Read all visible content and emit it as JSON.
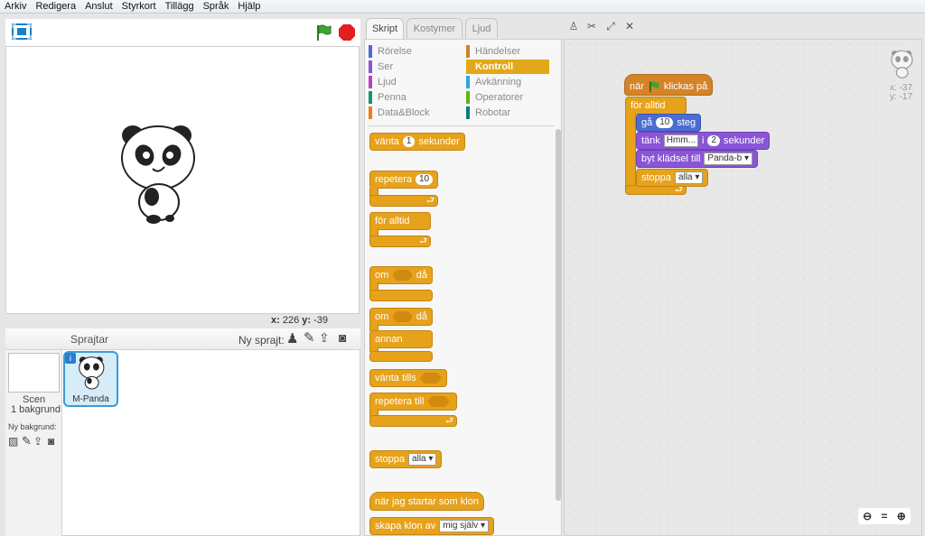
{
  "menu": [
    "Arkiv",
    "Redigera",
    "Anslut",
    "Styrkort",
    "Tillägg",
    "Språk",
    "Hjälp"
  ],
  "stage": {
    "coords": {
      "x_label": "x:",
      "x_value": "226",
      "y_label": "y:",
      "y_value": "-39"
    }
  },
  "sprites": {
    "header_label": "Sprajtar",
    "new_sprite_label": "Ny sprajt:",
    "stage_name": "Scen",
    "stage_backdrops": "1 bakgrund",
    "new_backdrop_label": "Ny bakgrund:",
    "selected_sprite": "M-Panda"
  },
  "tabs": [
    "Skript",
    "Kostymer",
    "Ljud"
  ],
  "categories_left": [
    {
      "label": "Rörelse",
      "color": "#4a6cd4"
    },
    {
      "label": "Ser",
      "color": "#8a55d7"
    },
    {
      "label": "Ljud",
      "color": "#bb42c3"
    },
    {
      "label": "Penna",
      "color": "#0e9a6c"
    },
    {
      "label": "Data&Block",
      "color": "#ee7d16"
    }
  ],
  "categories_right": [
    {
      "label": "Händelser",
      "color": "#c88330"
    },
    {
      "label": "Kontroll",
      "color": "#e1a91a"
    },
    {
      "label": "Avkänning",
      "color": "#2ca5e2"
    },
    {
      "label": "Operatorer",
      "color": "#5cb712"
    },
    {
      "label": "Robotar",
      "color": "#0e7a82"
    }
  ],
  "palette": {
    "wait": "vänta",
    "wait_val": "1",
    "wait_unit": "sekunder",
    "repeat": "repetera",
    "repeat_val": "10",
    "forever": "för alltid",
    "if": "om",
    "then": "då",
    "if2": "om",
    "then2": "då",
    "else": "annan",
    "wait_until": "vänta tills",
    "repeat_until": "repetera till",
    "stop": "stoppa",
    "stop_val": "alla",
    "clone_start": "när jag startar som klon",
    "create_clone": "skapa klon av",
    "create_clone_val": "mig själv"
  },
  "script": {
    "hat_prefix": "när",
    "hat_suffix": "klickas på",
    "forever": "för alltid",
    "move": "gå",
    "move_val": "10",
    "move_unit": "steg",
    "think": "tänk",
    "think_val": "Hmm...",
    "think_in": "i",
    "think_secs": "2",
    "think_unit": "sekunder",
    "switch": "byt klädsel till",
    "switch_val": "Panda-b",
    "stop": "stoppa",
    "stop_val": "alla"
  },
  "sprite_info": {
    "x": "x: -37",
    "y": "y: -17"
  },
  "colors": {
    "control": "#e6a21b",
    "events": "#d48329",
    "motion": "#4a6cd4",
    "looks": "#8a55d7",
    "selection": "#3a9ad9"
  }
}
